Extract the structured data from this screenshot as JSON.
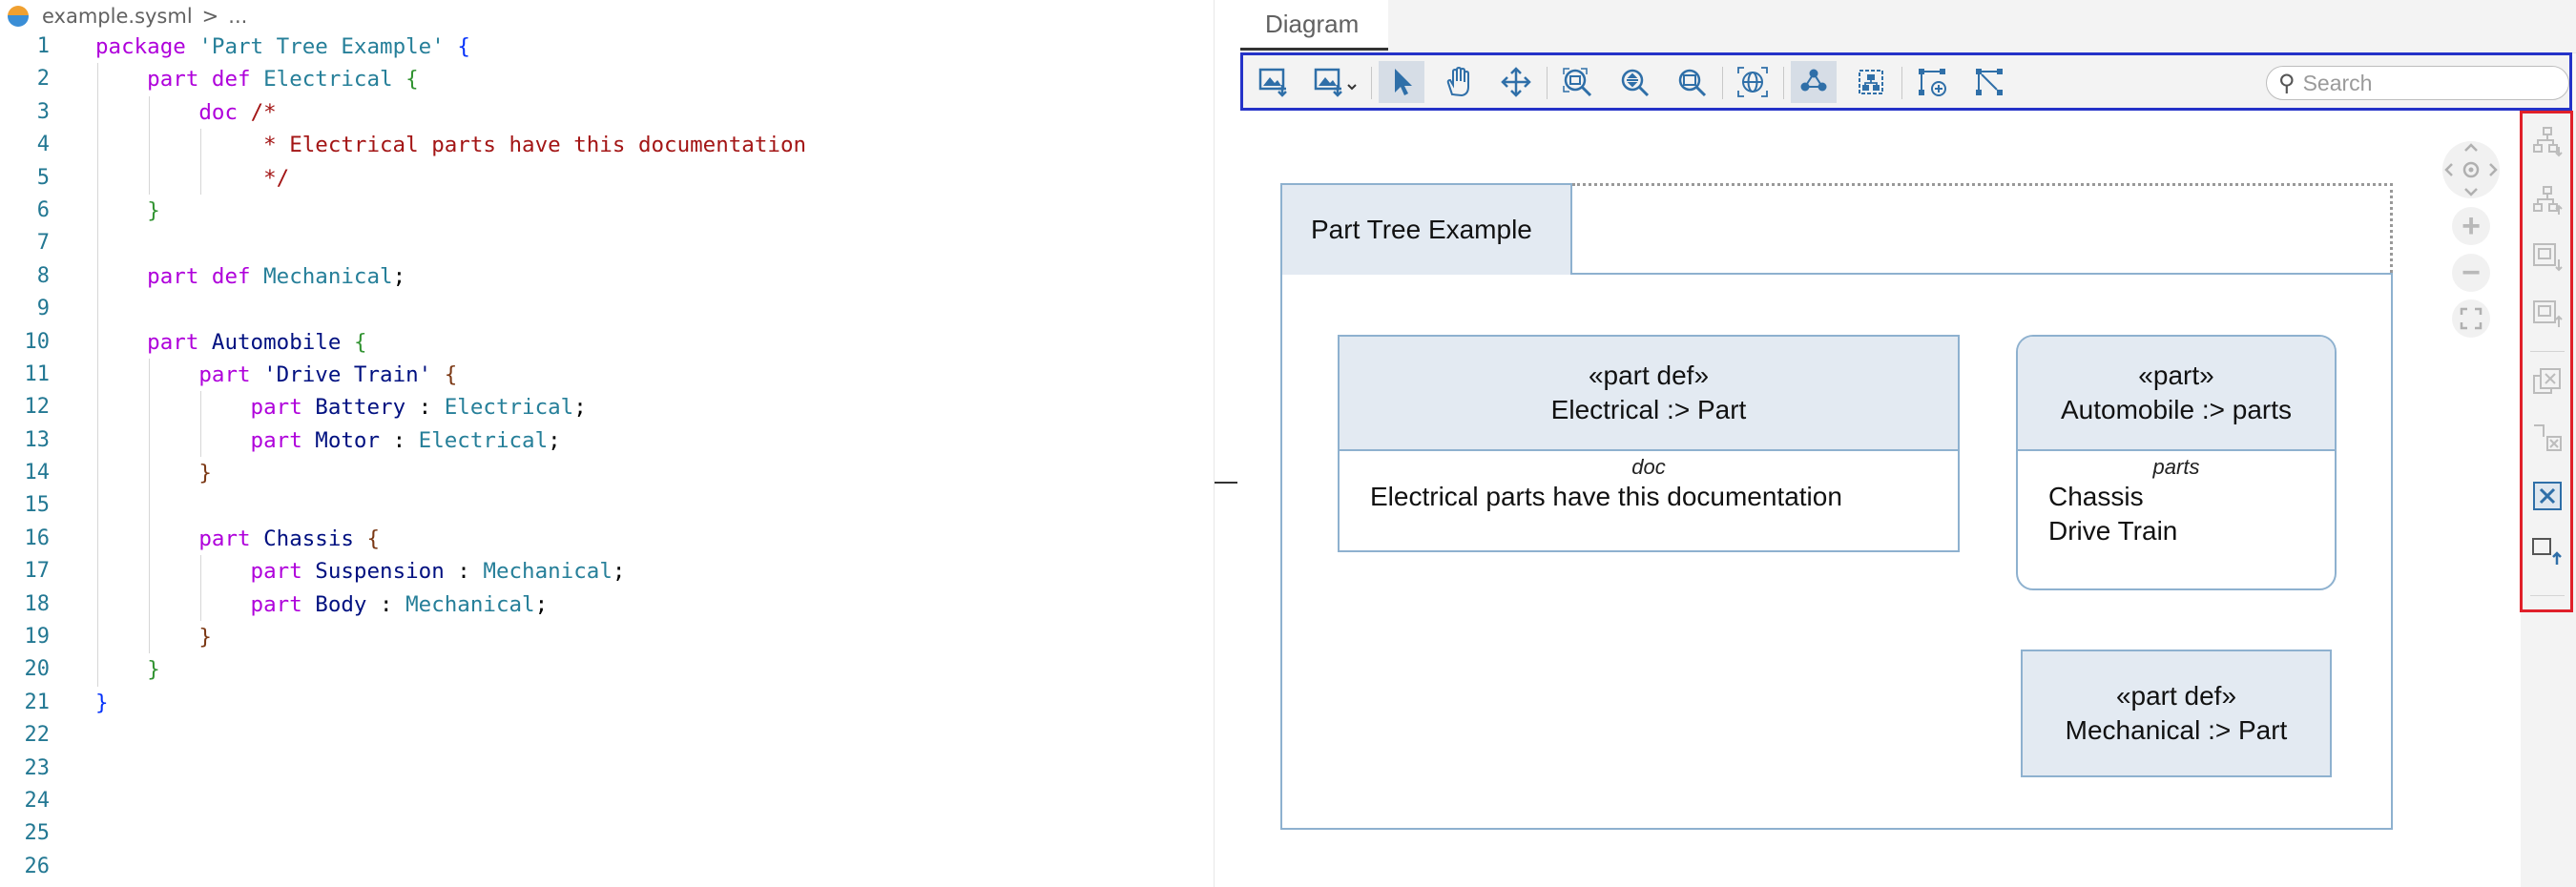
{
  "editor": {
    "breadcrumb": {
      "file": "example.sysml",
      "sep": ">",
      "rest": "..."
    },
    "lines": [
      [
        {
          "t": "package ",
          "c": "kw"
        },
        {
          "t": "'Part Tree Example'",
          "c": "str"
        },
        {
          "t": " ",
          "c": "pl"
        },
        {
          "t": "{",
          "c": "b1"
        }
      ],
      [
        {
          "t": "    part def ",
          "c": "kw"
        },
        {
          "t": "Electrical",
          "c": "ty"
        },
        {
          "t": " ",
          "c": "pl"
        },
        {
          "t": "{",
          "c": "b2"
        }
      ],
      [
        {
          "t": "        doc ",
          "c": "kw"
        },
        {
          "t": "/*",
          "c": "cm"
        }
      ],
      [
        {
          "t": "             * Electrical parts have this documentation",
          "c": "cm"
        }
      ],
      [
        {
          "t": "             */",
          "c": "cm"
        }
      ],
      [
        {
          "t": "    ",
          "c": "pl"
        },
        {
          "t": "}",
          "c": "b2"
        }
      ],
      [],
      [
        {
          "t": "    part def ",
          "c": "kw"
        },
        {
          "t": "Mechanical",
          "c": "ty"
        },
        {
          "t": ";",
          "c": "pl"
        }
      ],
      [],
      [
        {
          "t": "    part ",
          "c": "kw"
        },
        {
          "t": "Automobile",
          "c": "id"
        },
        {
          "t": " ",
          "c": "pl"
        },
        {
          "t": "{",
          "c": "b2"
        }
      ],
      [
        {
          "t": "        part ",
          "c": "kw"
        },
        {
          "t": "'Drive Train'",
          "c": "id"
        },
        {
          "t": " ",
          "c": "pl"
        },
        {
          "t": "{",
          "c": "b3"
        }
      ],
      [
        {
          "t": "            part ",
          "c": "kw"
        },
        {
          "t": "Battery",
          "c": "id"
        },
        {
          "t": " : ",
          "c": "pl"
        },
        {
          "t": "Electrical",
          "c": "ty"
        },
        {
          "t": ";",
          "c": "pl"
        }
      ],
      [
        {
          "t": "            part ",
          "c": "kw"
        },
        {
          "t": "Motor",
          "c": "id"
        },
        {
          "t": " : ",
          "c": "pl"
        },
        {
          "t": "Electrical",
          "c": "ty"
        },
        {
          "t": ";",
          "c": "pl"
        }
      ],
      [
        {
          "t": "        ",
          "c": "pl"
        },
        {
          "t": "}",
          "c": "b3"
        }
      ],
      [],
      [
        {
          "t": "        part ",
          "c": "kw"
        },
        {
          "t": "Chassis",
          "c": "id"
        },
        {
          "t": " ",
          "c": "pl"
        },
        {
          "t": "{",
          "c": "b3"
        }
      ],
      [
        {
          "t": "            part ",
          "c": "kw"
        },
        {
          "t": "Suspension",
          "c": "id"
        },
        {
          "t": " : ",
          "c": "pl"
        },
        {
          "t": "Mechanical",
          "c": "ty"
        },
        {
          "t": ";",
          "c": "pl"
        }
      ],
      [
        {
          "t": "            part ",
          "c": "kw"
        },
        {
          "t": "Body",
          "c": "id"
        },
        {
          "t": " : ",
          "c": "pl"
        },
        {
          "t": "Mechanical",
          "c": "ty"
        },
        {
          "t": ";",
          "c": "pl"
        }
      ],
      [
        {
          "t": "        ",
          "c": "pl"
        },
        {
          "t": "}",
          "c": "b3"
        }
      ],
      [
        {
          "t": "    ",
          "c": "pl"
        },
        {
          "t": "}",
          "c": "b2"
        }
      ],
      [
        {
          "t": "}",
          "c": "b1"
        }
      ],
      [],
      [],
      [],
      [],
      []
    ]
  },
  "diagram": {
    "tab_label": "Diagram",
    "search_placeholder": "Search",
    "toolbar_icons": [
      "export-image-icon",
      "export-image-dropdown-icon",
      "pointer-icon",
      "pan-hand-icon",
      "move-icon",
      "zoom-to-fit-icon",
      "zoom-selection-icon",
      "zoom-reset-icon",
      "globe-icon",
      "layout-icon",
      "hierarchy-layout-icon",
      "add-node-icon",
      "connect-nodes-icon"
    ],
    "package": {
      "name": "Part Tree Example"
    },
    "nodes": {
      "electrical": {
        "stereotype": "«part def»",
        "name": "Electrical :> Part",
        "compartment": "doc",
        "items": [
          "Electrical parts have this documentation"
        ]
      },
      "automobile": {
        "stereotype": "«part»",
        "name": "Automobile :> parts",
        "compartment": "parts",
        "items": [
          "Chassis",
          "Drive Train"
        ]
      },
      "mechanical": {
        "stereotype": "«part def»",
        "name": "Mechanical :> Part"
      }
    },
    "nav_controls": {
      "zoom_in": "+",
      "zoom_out": "−"
    }
  },
  "colors": {
    "toolbar_highlight": "#2432c8",
    "sidebar_highlight": "#e0202a",
    "node_fill": "#e3eaf2",
    "node_border": "#8eb1cf"
  }
}
